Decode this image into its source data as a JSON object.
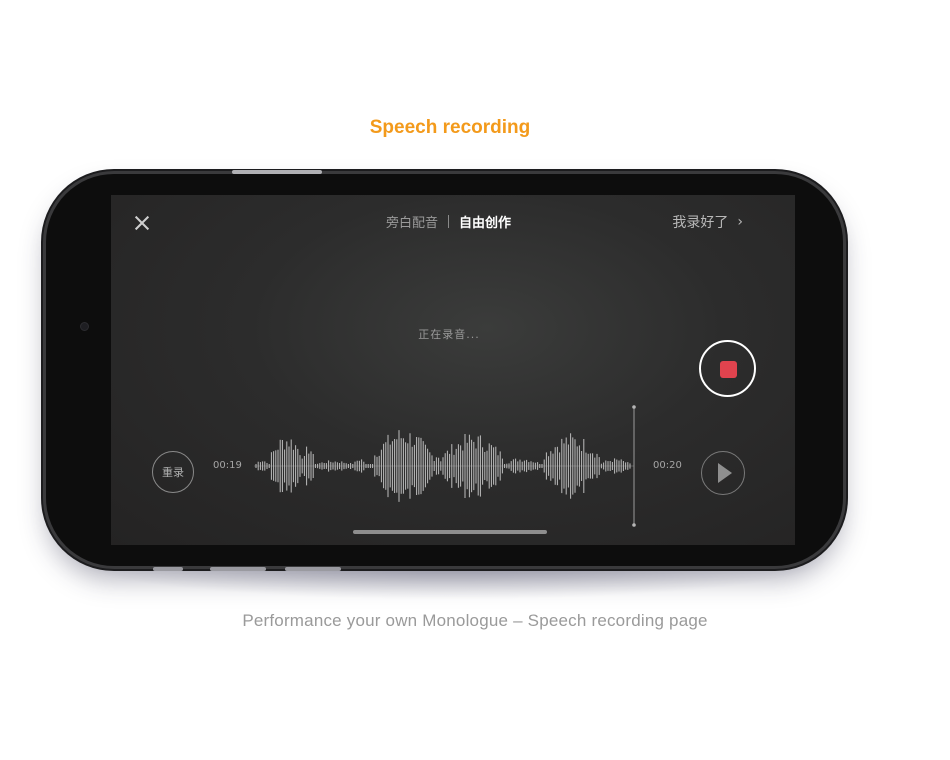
{
  "heading": "Speech recording",
  "caption": "Performance your own Monologue – Speech recording page",
  "screen": {
    "tabs": [
      {
        "label": "旁白配音",
        "active": false
      },
      {
        "label": "自由创作",
        "active": true
      }
    ],
    "done_label": "我录好了",
    "status_text": "正在录音...",
    "rerecord_label": "重录",
    "time_elapsed": "00:19",
    "time_total": "00:20"
  },
  "colors": {
    "heading_accent": "#f39a1b",
    "record_stop": "#e0434e"
  },
  "icons": {
    "close": "close-icon",
    "chevron": "chevron-right-icon",
    "record": "stop-record-icon",
    "play": "play-icon"
  }
}
